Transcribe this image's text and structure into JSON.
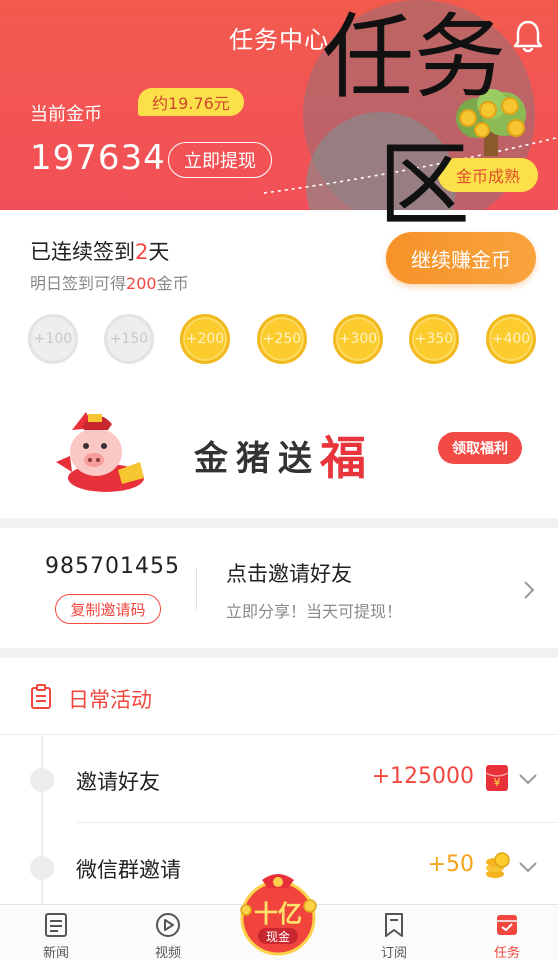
{
  "header": {
    "title": "任务中心",
    "coin_label": "当前金币",
    "approx_value": "约19.76元",
    "coin_amount": "197634",
    "withdraw_label": "立即提现",
    "release_label": "金币成熟"
  },
  "overlay": {
    "line1": "任务",
    "line2": "区"
  },
  "signin": {
    "prefix": "已连续签到",
    "days": "2",
    "suffix": "天",
    "tomorrow_prefix": "明日签到可得",
    "tomorrow_amount": "200",
    "tomorrow_suffix": "金币",
    "earn_button": "继续赚金币",
    "coins": [
      {
        "label": "+100",
        "status": "done"
      },
      {
        "label": "+150",
        "status": "done"
      },
      {
        "label": "+200",
        "status": "todo"
      },
      {
        "label": "+250",
        "status": "todo"
      },
      {
        "label": "+300",
        "status": "todo"
      },
      {
        "label": "+350",
        "status": "todo"
      },
      {
        "label": "+400",
        "status": "todo"
      }
    ]
  },
  "banner": {
    "title_main": "金猪送",
    "title_highlight": "福",
    "welfare_button": "领取福利"
  },
  "invite": {
    "code": "985701455",
    "copy_button": "复制邀请码",
    "title": "点击邀请好友",
    "subtitle": "立即分享！当天可提现！"
  },
  "daily": {
    "title": "日常活动",
    "tasks": [
      {
        "name": "邀请好友",
        "reward": "+125000",
        "icon": "red-envelope-icon"
      },
      {
        "name": "微信群邀请",
        "reward": "+50",
        "icon": "coin-stack-icon"
      }
    ]
  },
  "tabbar": {
    "tabs": [
      {
        "label": "新闻",
        "icon": "news-icon"
      },
      {
        "label": "视频",
        "icon": "play-icon"
      },
      {
        "label": "订阅",
        "icon": "bookmark-icon"
      },
      {
        "label": "任务",
        "icon": "task-icon"
      }
    ],
    "center_main": "十亿",
    "center_sub": "现金"
  },
  "colors": {
    "brand_red": "#f2473f",
    "header_red": "#f25058",
    "gold": "#fccb2e",
    "orange": "#f7922a"
  }
}
